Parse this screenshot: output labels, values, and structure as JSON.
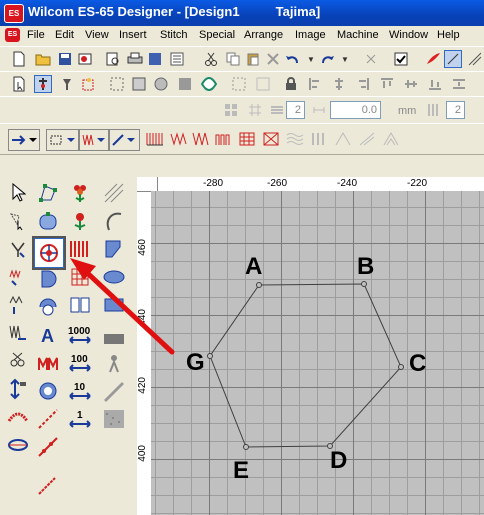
{
  "window": {
    "title": "Wilcom ES-65 Designer - [Design1          Tajima]",
    "app_icon": "ES"
  },
  "menu": {
    "icon": "ES",
    "items": [
      "File",
      "Edit",
      "View",
      "Insert",
      "Stitch",
      "Special",
      "Arrange",
      "Image",
      "Machine",
      "Window",
      "Help"
    ]
  },
  "toolbar3": {
    "field1": "2",
    "field2": "0.0",
    "unit": "mm",
    "field3": "2"
  },
  "ruler": {
    "top_ticks": [
      "-280",
      "-260",
      "-240",
      "-220"
    ],
    "left_ticks": [
      "460",
      "440",
      "420",
      "400"
    ]
  },
  "shape": {
    "type": "hexagon outline",
    "vertex_labels": [
      "A",
      "B",
      "C",
      "D",
      "E",
      "G"
    ]
  },
  "annotation": {
    "arrow_color": "#E01010",
    "highlight_tool": "reshape-object-tool"
  },
  "colors": {
    "titlebar": "#0A5BE4",
    "canvas": "#C0C0C0",
    "desktop": "#ECE9D8"
  }
}
